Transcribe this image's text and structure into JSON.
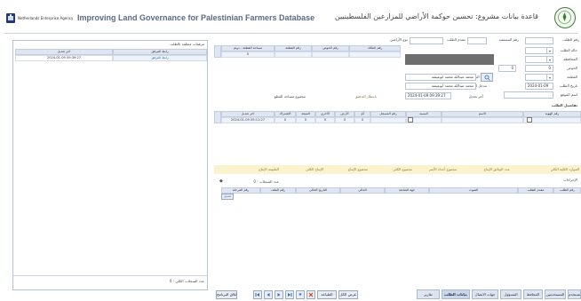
{
  "header": {
    "title_en": "Improving Land Governance for Palestinian Farmers Database",
    "title_ar": "قاعدة بيانات مشروع: تحسين حوكمة الأراضي للمزارعين الفلسطينيين",
    "agency": "Netherlands Enterprise Agency"
  },
  "left_panel": {
    "title": "مرفقات متعلقة بالطلب",
    "col_link": "رابط المرفق",
    "col_date": "آخر تعديل",
    "row_link": "رابط المرفق",
    "row_date": "2024-01-09 09:39:27",
    "footer": "عدد السجلات الكلي : 0"
  },
  "request": {
    "lbl_request_no": "رقم الطلب",
    "lbl_applicant": "مقدم الطلب",
    "lbl_applicant_id": "رقم المستفيد",
    "lbl_land_type": "نوع الأراضي",
    "lbl_status": "حالة الطلب",
    "lbl_governorate": "المحافظة",
    "lbl_basin": "الحوض",
    "lbl_parcel": "القطعة",
    "lbl_request_date": "تاريخ الطلب",
    "request_date": "2024-01-09",
    "lbl_site": "اسم الموقع",
    "lbl_field_worker": "اسم الباحث الميداني",
    "field_worker_1": "محمد عبدالله محمد ابوعيشة",
    "lbl_data_entry": "مدخل البيانات",
    "field_worker_2": "محمد عبدالله محمد ابوعيشة",
    "lbl_last_edit": "آخر تعديل",
    "last_edit": "2024-01-09 09:39:27",
    "lbl_created": "تاريخ الإدخال",
    "lbl_notes": "ملاحظات",
    "lbl_total": "مجموع مساحة القطع",
    "num_1": "0",
    "num_2": "0",
    "section": "تفاصيل الطلب",
    "approval_note": "بانتظار التدقيق"
  },
  "parcels": {
    "headers": [
      "رقم المالك",
      "رقم الحوض",
      "رقم القطعة",
      "مساحة القطعة - دونم"
    ],
    "row": [
      "",
      "",
      "",
      "0"
    ]
  },
  "owners": {
    "headers": [
      "رقم الهوية",
      "الاسم",
      "النسبة",
      "رقم المسجل",
      "كل",
      "الأرض",
      "الأخرى",
      "النتيجة",
      "الإشتراك",
      "آخر تعديل"
    ],
    "row": [
      "",
      "",
      "",
      "",
      "0",
      "0",
      "0",
      "0",
      "0",
      "2024-01-09 09:11:27"
    ]
  },
  "totals": {
    "headers": [
      "الموارد الكلية الكلي",
      "عدد الوثائق الإنتاج",
      "مجموع أعداد الأسر",
      "مجموع الكلي",
      "مجموع الإنتاج",
      "الإنتاج الكلي",
      "الطبيعة الإنتاج"
    ]
  },
  "notes_section": {
    "lbl": "الإجراءات",
    "count": "عدد السجلات : 0"
  },
  "actions_table": {
    "headers": [
      "رقم الطلب",
      "مقدم الطلب",
      "الصوت",
      "جهة المتابعة",
      "الحالي",
      "التاريخ الحالي",
      "رقم الملف",
      "رقم المرحلة"
    ],
    "row_btn": "تعديل"
  },
  "tabs": [
    "المستخدم",
    "المستخدمين",
    "المحافظ",
    "المسؤول",
    "جهات الاتصال",
    "بيانات الطلب",
    "تقارير"
  ],
  "nav": {
    "filter": "عرض الكل",
    "print": "الطباعة",
    "delete": "حذف",
    "close": "إغلاق البرنامج"
  },
  "colors": {
    "accent": "#2f6fb8",
    "header_bg": "#dfe6f2",
    "yellow_bar": "#fbf2cf",
    "gray_box": "#6e6e6e"
  }
}
